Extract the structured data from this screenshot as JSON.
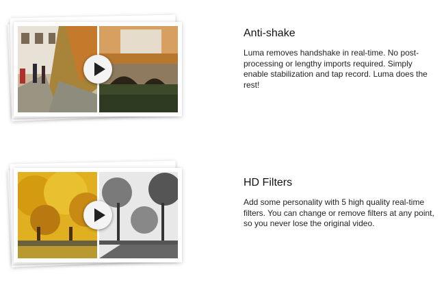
{
  "features": [
    {
      "title": "Anti-shake",
      "description": "Luma removes handshake in real-time. No post-processing or lengthy imports required. Simply enable stabilization and tap record. Luma does the rest!"
    },
    {
      "title": "HD Filters",
      "description": "Add some personality with 5 high quality real-time filters. You can change or remove filters at any point, so you never lose the original video."
    }
  ],
  "icons": {
    "play": "play-icon"
  },
  "colors": {
    "heading": "#111111",
    "body": "#222222",
    "play_button": "#f4f4f4"
  }
}
